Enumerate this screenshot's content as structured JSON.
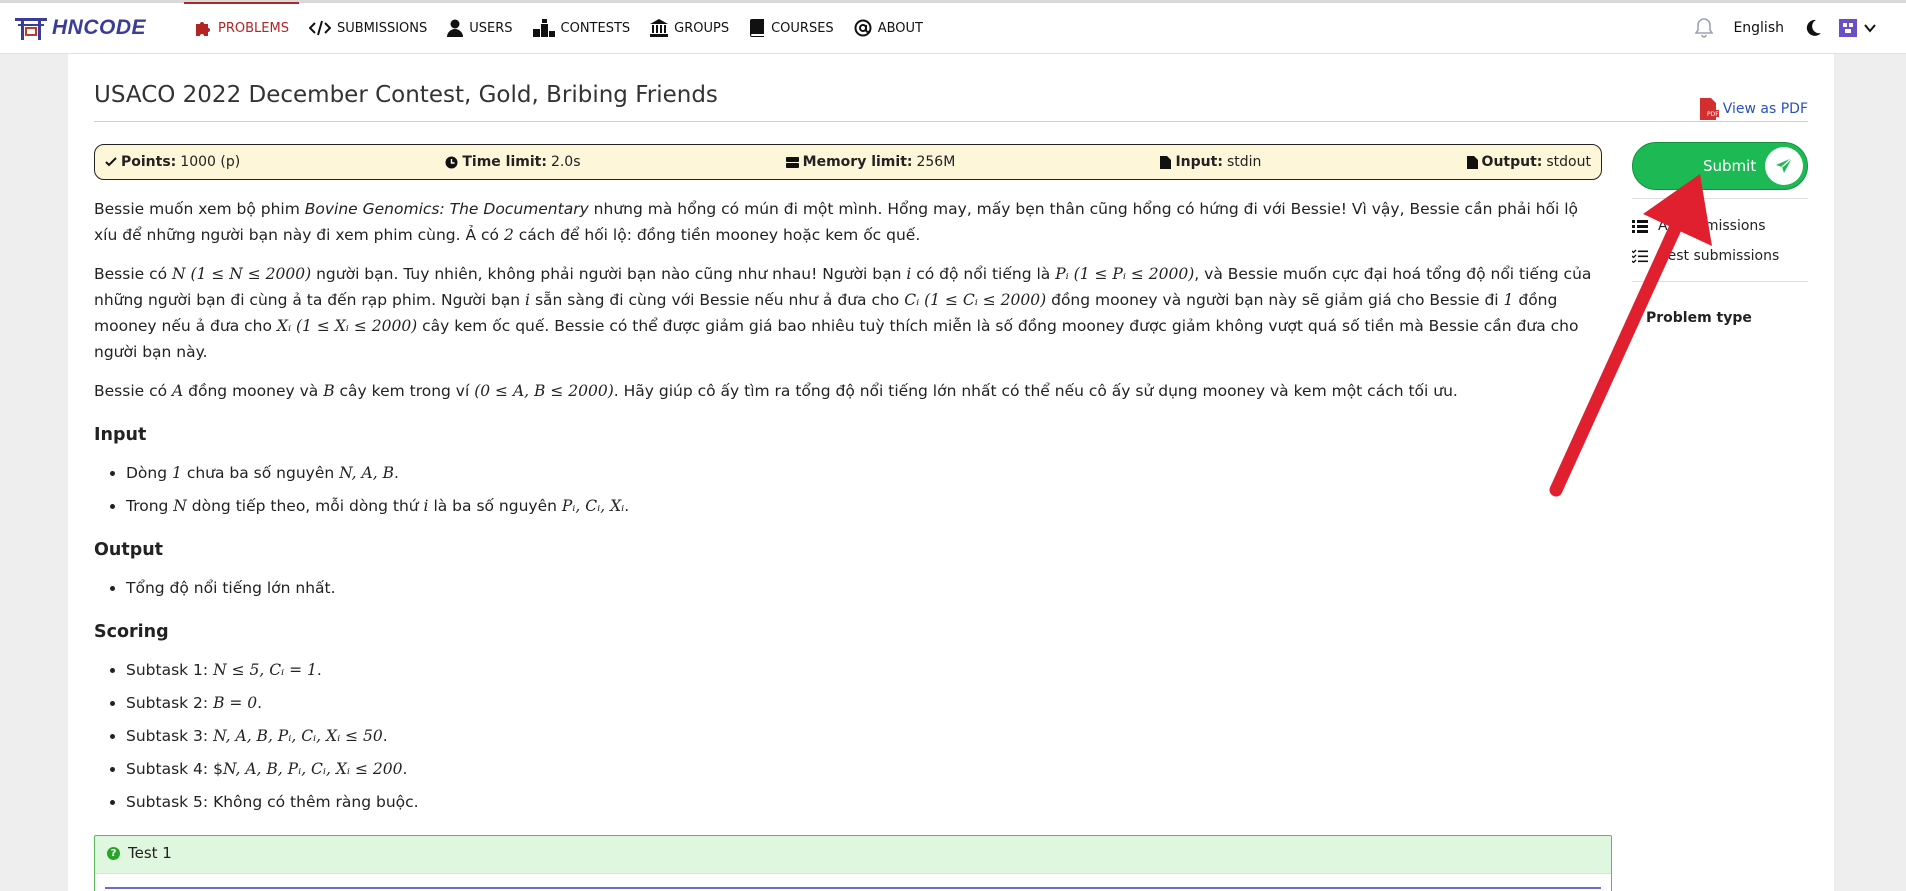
{
  "nav": {
    "logo_text": "HNCODE",
    "items": [
      {
        "label": "PROBLEMS",
        "icon": "puzzle-icon"
      },
      {
        "label": "SUBMISSIONS",
        "icon": "code-icon"
      },
      {
        "label": "USERS",
        "icon": "user-icon"
      },
      {
        "label": "CONTESTS",
        "icon": "podium-icon"
      },
      {
        "label": "GROUPS",
        "icon": "institution-icon"
      },
      {
        "label": "COURSES",
        "icon": "book-icon"
      },
      {
        "label": "ABOUT",
        "icon": "at-icon"
      }
    ],
    "language": "English"
  },
  "problem": {
    "title": "USACO 2022 December Contest, Gold, Bribing Friends",
    "pdf_label": "View as PDF",
    "info": {
      "points_label": "Points:",
      "points_value": "1000 (p)",
      "time_label": "Time limit:",
      "time_value": "2.0s",
      "memory_label": "Memory limit:",
      "memory_value": "256M",
      "input_label": "Input:",
      "input_value": "stdin",
      "output_label": "Output:",
      "output_value": "stdout"
    },
    "p1_a": "Bessie muốn xem bộ phim ",
    "p1_title": "Bovine Genomics: The Documentary",
    "p1_b": " nhưng mà hổng có mún đi một mình. Hổng may, mấy bẹn thân cũng hổng có hứng đi với Bessie! Vì vậy, Bessie cần phải hối lộ xíu để những người bạn này đi xem phim cùng. Ả có ",
    "p1_math": "2",
    "p1_c": " cách để hối lộ: đồng tiền mooney hoặc kem ốc quế.",
    "p2_a": "Bessie có ",
    "p2_m1": "N (1 ≤ N ≤ 2000)",
    "p2_b": " người bạn. Tuy nhiên, không phải người bạn nào cũng như nhau! Người bạn ",
    "p2_m2": "i",
    "p2_c": " có độ nổi tiếng là ",
    "p2_m3": "Pᵢ (1 ≤ Pᵢ ≤ 2000)",
    "p2_d": ", và Bessie muốn cực đại hoá tổng độ nổi tiếng của những người bạn đi cùng ả ta đến rạp phim. Người bạn ",
    "p2_m4": "i",
    "p2_e": " sẵn sàng đi cùng với Bessie nếu như ả đưa cho ",
    "p2_m5": "Cᵢ (1 ≤ Cᵢ ≤ 2000)",
    "p2_f": " đồng mooney và người bạn này sẽ giảm giá cho Bessie đi ",
    "p2_m6": "1",
    "p2_g": " đồng mooney nếu ả đưa cho ",
    "p2_m7": "Xᵢ (1 ≤ Xᵢ ≤ 2000)",
    "p2_h": " cây kem ốc quế. Bessie có thể được giảm giá bao nhiêu tuỳ thích miễn là số đồng mooney được giảm không vượt quá số tiền mà Bessie cần đưa cho người bạn này.",
    "p3_a": "Bessie có ",
    "p3_m1": "A",
    "p3_b": " đồng mooney và ",
    "p3_m2": "B",
    "p3_c": " cây kem trong ví ",
    "p3_m3": "(0 ≤ A, B ≤ 2000)",
    "p3_d": ". Hãy giúp cô ấy tìm ra tổng độ nổi tiếng lớn nhất có thể nếu cô ấy sử dụng mooney và kem một cách tối ưu.",
    "input_heading": "Input",
    "input_1a": "Dòng ",
    "input_1m1": "1",
    "input_1b": " chưa ba số nguyên ",
    "input_1m2": "N, A, B",
    "input_1c": ".",
    "input_2a": "Trong ",
    "input_2m1": "N",
    "input_2b": " dòng tiếp theo, mỗi dòng thứ ",
    "input_2m2": "i",
    "input_2c": " là ba số nguyên ",
    "input_2m3": "Pᵢ, Cᵢ, Xᵢ",
    "input_2d": ".",
    "output_heading": "Output",
    "output_1": "Tổng độ nổi tiếng lớn nhất.",
    "scoring_heading": "Scoring",
    "scoring": [
      {
        "label": "Subtask 1: ",
        "math": "N ≤ 5, Cᵢ = 1",
        "end": "."
      },
      {
        "label": "Subtask 2: ",
        "math": "B = 0",
        "end": "."
      },
      {
        "label": "Subtask 3: ",
        "math": "N, A, B, Pᵢ, Cᵢ, Xᵢ ≤ 50",
        "end": "."
      },
      {
        "label": "Subtask 4: $",
        "math": "N, A, B, Pᵢ, Cᵢ, Xᵢ ≤ 200",
        "end": "."
      },
      {
        "label": "Subtask 5: Không có thêm ràng buộc.",
        "math": "",
        "end": ""
      }
    ],
    "test_label": "Test 1"
  },
  "sidebar": {
    "submit_label": "Submit",
    "all_submissions": "All submissions",
    "best_submissions": "Best submissions",
    "problem_type": "Problem type"
  },
  "colors": {
    "accent_red": "#b32424",
    "submit_green": "#1db954",
    "arrow_red": "#e0202e"
  }
}
